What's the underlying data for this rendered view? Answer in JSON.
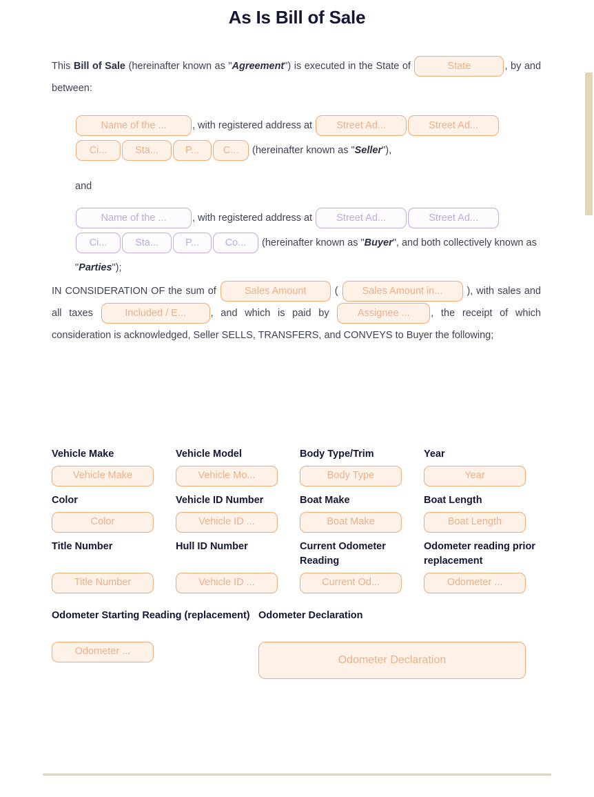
{
  "document": {
    "title": "As Is Bill of Sale"
  },
  "intro": {
    "t1": "This ",
    "bill_of_sale": "Bill of Sale",
    "t2": " (hereinafter known as \"",
    "agreement": "Agreement",
    "t3": "\") is executed in the State of ",
    "t4": ", by and between:",
    "state_field": "State"
  },
  "seller": {
    "name_field": "Name of the ...",
    "mid_text": ", with  registered address at ",
    "street1_field": "Street Ad...",
    "street2_field": "Street Ad...",
    "city_field": "Ci...",
    "state_field": "Sta...",
    "postal_field": "P...",
    "country_field": "C...",
    "tail_open": " (hereinafter known as \"",
    "label": "Seller",
    "tail_close": "\"),"
  },
  "separator": {
    "and": "and"
  },
  "buyer": {
    "name_field": "Name of the ...",
    "mid_text": ", with registered address at ",
    "street1_field": "Street Ad...",
    "street2_field": "Street Ad...",
    "city_field": "Ci...",
    "state_field": "Sta...",
    "postal_field": "P...",
    "country_field": "Co...",
    "tail_open": " (hereinafter known as \"",
    "label": "Buyer",
    "tail_mid": "\", and both collectively known as \"",
    "parties_label": "Parties",
    "tail_close": "\");"
  },
  "consideration": {
    "t1": "IN CONSIDERATION OF the sum of ",
    "amount_field": "Sales Amount",
    "t2": " ( ",
    "amount_words_field": "Sales Amount in...",
    "t3": " ), with sales and all taxes ",
    "included_field": "Included / E...",
    "t4": ", and which is paid by ",
    "assignee_field": "Assignee ...",
    "t5": ", the receipt of which consideration is acknowledged, Seller SELLS, TRANSFERS, and CONVEYS to Buyer the following;"
  },
  "vehicle_details": {
    "rows": [
      [
        {
          "label": "Vehicle Make",
          "placeholder": "Vehicle Make"
        },
        {
          "label": "Vehicle Model",
          "placeholder": "Vehicle Mo..."
        },
        {
          "label": "Body Type/Trim",
          "placeholder": "Body Type"
        },
        {
          "label": "Year",
          "placeholder": "Year"
        }
      ],
      [
        {
          "label": "Color",
          "placeholder": "Color"
        },
        {
          "label": "Vehicle ID Number",
          "placeholder": "Vehicle ID ..."
        },
        {
          "label": "Boat Make",
          "placeholder": "Boat Make"
        },
        {
          "label": "Boat Length",
          "placeholder": "Boat Length"
        }
      ],
      [
        {
          "label": "Title Number",
          "placeholder": "Title Number"
        },
        {
          "label": "Hull ID Number",
          "placeholder": "Vehicle ID ..."
        },
        {
          "label": "Current Odometer Reading",
          "placeholder": "Current Od..."
        },
        {
          "label": "Odometer reading prior replacement",
          "placeholder": "Odometer ..."
        }
      ]
    ],
    "last_row": {
      "starting_reading": {
        "label": "Odometer Starting Reading (replacement)",
        "placeholder": "Odometer ..."
      },
      "declaration": {
        "label": "Odometer Declaration",
        "placeholder": "Odometer Declaration"
      }
    }
  },
  "colors": {
    "title": "#141635",
    "body_text": "#3f4254",
    "seller_accent": "#f0ab74",
    "seller_fill": "#fdf1e8",
    "buyer_accent": "#c3a9e3",
    "buyer_fill": "#fcfbfe",
    "divider": "#e3d3ae",
    "scrollbar": "#e3d6b2"
  }
}
